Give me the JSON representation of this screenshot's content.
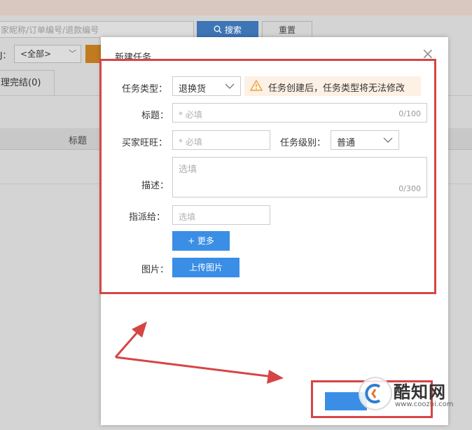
{
  "background": {
    "search_placeholder": "家昵称/订单编号/退款编号",
    "search_button": "搜索",
    "reset_button": "重置",
    "filter_label": "J：",
    "filter_value": "<全部>",
    "tab_label": "理完结(0)",
    "table_header_title": "标题"
  },
  "modal": {
    "title": "新建任务",
    "task_type": {
      "label": "任务类型：",
      "value": "退换货"
    },
    "warning": "任务创建后，任务类型将无法修改",
    "title_field": {
      "label": "标题：",
      "placeholder": "* 必填",
      "counter": "0/100"
    },
    "buyer": {
      "label": "买家旺旺：",
      "placeholder": "* 必填"
    },
    "level": {
      "label": "任务级别：",
      "value": "普通"
    },
    "desc": {
      "label": "描述：",
      "placeholder": "选填",
      "counter": "0/300"
    },
    "assign": {
      "label": "指派给：",
      "placeholder": "选填"
    },
    "more_button": "+ 更多",
    "image": {
      "label": "图片：",
      "button": "上传图片"
    }
  },
  "watermark": {
    "name": "酷知网",
    "url": "www.coozhi.com"
  },
  "colors": {
    "primary": "#3a8ee6",
    "annotation": "#d64545",
    "warning_bg": "#fdf0e4",
    "warning_icon": "#e8a33d"
  }
}
